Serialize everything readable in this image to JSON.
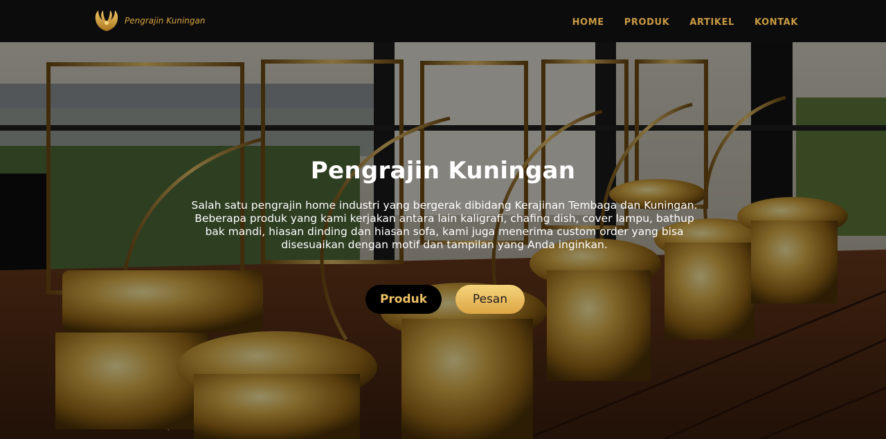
{
  "colors": {
    "navbar_bg": "#0c0c0c",
    "brand_gold": "#d9a441",
    "nav_link": "#c99a43",
    "button_dark_bg": "#000000",
    "button_dark_text": "#ecc064",
    "button_gold_bg": "#e9bb5c",
    "button_gold_text": "#1b1b1b"
  },
  "header": {
    "brand": {
      "logo_icon": "golden-wings-logo",
      "name": "Pengrajin Kuningan"
    },
    "nav": [
      {
        "label": "HOME"
      },
      {
        "label": "PRODUK"
      },
      {
        "label": "ARTIKEL"
      },
      {
        "label": "KONTAK"
      }
    ]
  },
  "hero": {
    "background_image": "brass chafing dishes and ornate gold hanging frames on a wooden floor",
    "title": "Pengrajin Kuningan",
    "description": "Salah satu pengrajin home industri yang bergerak dibidang Kerajinan Tembaga dan Kuningan. Beberapa produk yang kami kerjakan antara lain kaligrafi, chafing dish, cover lampu, bathup bak mandi, hiasan dinding dan hiasan sofa, kami juga menerima custom order yang bisa disesuaikan dengan motif dan tampilan yang Anda inginkan.",
    "buttons": {
      "primary": "Produk",
      "secondary": "Pesan"
    }
  }
}
